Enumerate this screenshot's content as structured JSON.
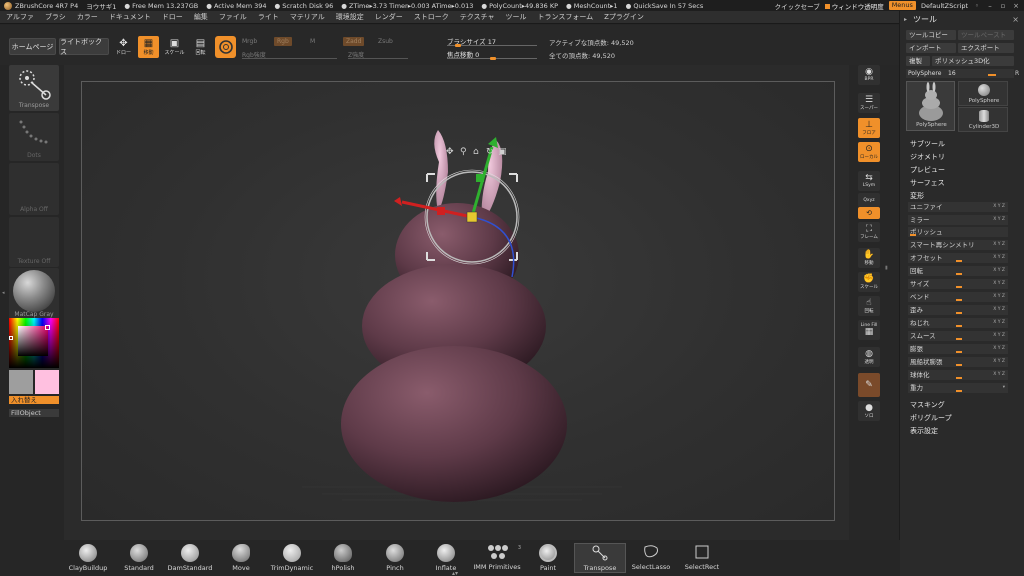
{
  "titlebar": {
    "items": [
      "ZBrushCore 4R7 P4",
      "ヨウサギ1",
      "● Free Mem 13.237GB",
      "● Active Mem 394",
      "● Scratch Disk 96",
      "● ZTime▸3.73 Timer▸0.003 ATime▸0.013",
      "● PolyCount▸49.836 KP",
      "● MeshCount▸1",
      "● QuickSave In 57 Secs"
    ],
    "quicksave": "クイックセーブ",
    "window_transparency": "ウィンドウ透明度",
    "menus": "Menus",
    "script": "DefaultZScript"
  },
  "menubar": [
    "アルファ",
    "ブラシ",
    "カラー",
    "ドキュメント",
    "ドロー",
    "編集",
    "ファイル",
    "ライト",
    "マテリアル",
    "環境設定",
    "レンダー",
    "ストローク",
    "テクスチャ",
    "ツール",
    "トランスフォーム",
    "Zプラグイン"
  ],
  "topshelf": {
    "home": "ホームページ",
    "lightbox": "ライトボックス",
    "icon_labels": [
      "ドロー",
      "移動",
      "スケール",
      "回転"
    ],
    "mrgb": "Mrgb",
    "rgb": "Rgb",
    "m": "M",
    "zadd": "Zadd",
    "zsub": "Zsub",
    "rgb_intensity": "Rgb強度",
    "z_intensity": "Z強度",
    "brush_size_label": "ブラシサイズ 17",
    "focal_shift_label": "焦点移動 0",
    "active_points": "アクティブな頂点数: 49,520",
    "total_points": "全ての頂点数: 49,520"
  },
  "leftshelf": {
    "transpose": "Transpose",
    "dots": "Dots",
    "alpha": "Alpha Off",
    "texture": "Texture Off",
    "matcap": "MatCap Gray",
    "swap": "入れ替え",
    "fillobject": "FillObject",
    "main_color": "#9e9e9e",
    "secondary_color": "#ffc0e0"
  },
  "rightshelf": {
    "labels": [
      "BPR",
      "スーパー",
      "フロア",
      "ローカル",
      "LSym",
      "Qxyz",
      "",
      "フレーム",
      "移動",
      "スケール",
      "回転",
      "Line Fill",
      "透明",
      "",
      "ソロ"
    ]
  },
  "toolpalette": {
    "title": "ツール",
    "copy": "ツールコピー",
    "paste": "ツールペースト",
    "import": "インポート",
    "export": "エクスポート",
    "clone": "複製",
    "make_polymesh": "ポリメッシュ3D化",
    "polysphere_label": "PolySphere",
    "polysphere_value": "16",
    "polysphere_r": "R",
    "thumbs": [
      "PolySphere",
      "PolySphere",
      "Cylinder3D"
    ],
    "sections": [
      "サブツール",
      "ジオメトリ",
      "プレビュー",
      "サーフェス",
      "変形"
    ],
    "deform_items": [
      "ユニファイ",
      "ミラー",
      "ポリッシュ",
      "スマート再シンメトリ",
      "オフセット",
      "回転",
      "サイズ",
      "ベンド",
      "歪み",
      "ねじれ",
      "スムース",
      "膨張",
      "風船状膨張",
      "球体化",
      "重力"
    ],
    "xyz_label": "X Y Z",
    "bottom_sections": [
      "マスキング",
      "ポリグループ",
      "表示設定"
    ]
  },
  "bottomshelf": {
    "brushes": [
      "ClayBuildup",
      "Standard",
      "DamStandard",
      "Move",
      "TrimDynamic",
      "hPolish",
      "Pinch",
      "Inflate",
      "IMM Primitives",
      "Paint",
      "Transpose",
      "SelectLasso",
      "SelectRect"
    ],
    "imm_count": "3"
  },
  "colors": {
    "accent": "#f0902a",
    "model": "#6b4250",
    "ears": "#d8a8c0"
  }
}
